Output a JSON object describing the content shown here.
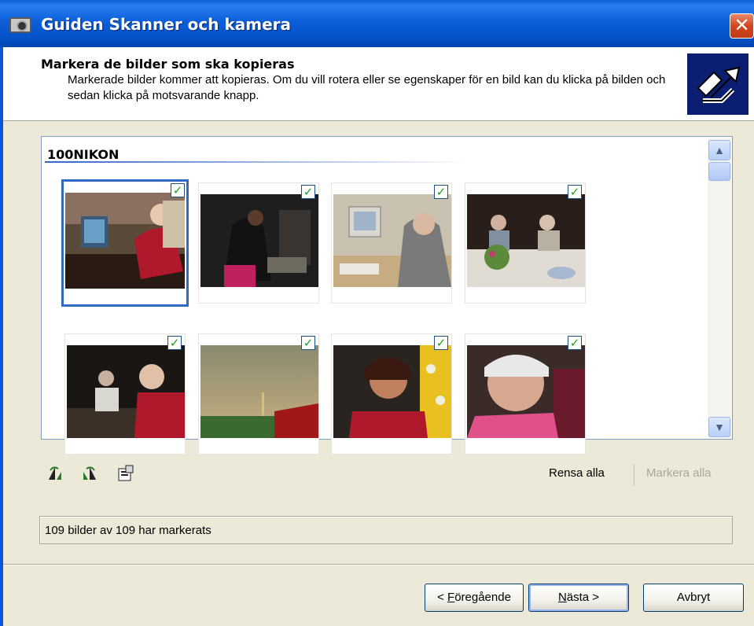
{
  "window": {
    "title": "Guiden Skanner och kamera",
    "close_glyph": "✕"
  },
  "header": {
    "title": "Markera de bilder som ska kopieras",
    "subtitle": "Markerade bilder kommer att kopieras. Om du vill rotera eller se egenskaper för en bild kan du klicka på bilden och sedan klicka på motsvarande knapp."
  },
  "gallery": {
    "group": "100NIKON",
    "thumbnails": [
      {
        "subject": "woman in red sweater at computer desk",
        "checked": true,
        "selected": true
      },
      {
        "subject": "person leaning over table in dark room",
        "checked": true,
        "selected": false
      },
      {
        "subject": "man typing at computer",
        "checked": true,
        "selected": false
      },
      {
        "subject": "people at dinner table with flowers",
        "checked": true,
        "selected": false
      },
      {
        "subject": "people eating at dim table",
        "checked": true,
        "selected": false
      },
      {
        "subject": "sunset sky over field with red barn",
        "checked": true,
        "selected": false
      },
      {
        "subject": "smiling woman against yellow curtain",
        "checked": true,
        "selected": false
      },
      {
        "subject": "close-up of woman with white hair",
        "checked": true,
        "selected": false
      }
    ],
    "check_glyph": "✓"
  },
  "scrollbar": {
    "up_glyph": "▲",
    "down_glyph": "▼"
  },
  "toolbar": {
    "icons": [
      "rotate-left-icon",
      "rotate-right-icon",
      "properties-icon"
    ],
    "clear_all": "Rensa alla",
    "mark_all": "Markera alla"
  },
  "status": {
    "text": "109 bilder av 109 har markerats"
  },
  "buttons": {
    "back_key": "F",
    "back_pre": "< ",
    "back_post": "öregående",
    "next_key": "N",
    "next_post": "ästa >",
    "cancel": "Avbryt"
  }
}
